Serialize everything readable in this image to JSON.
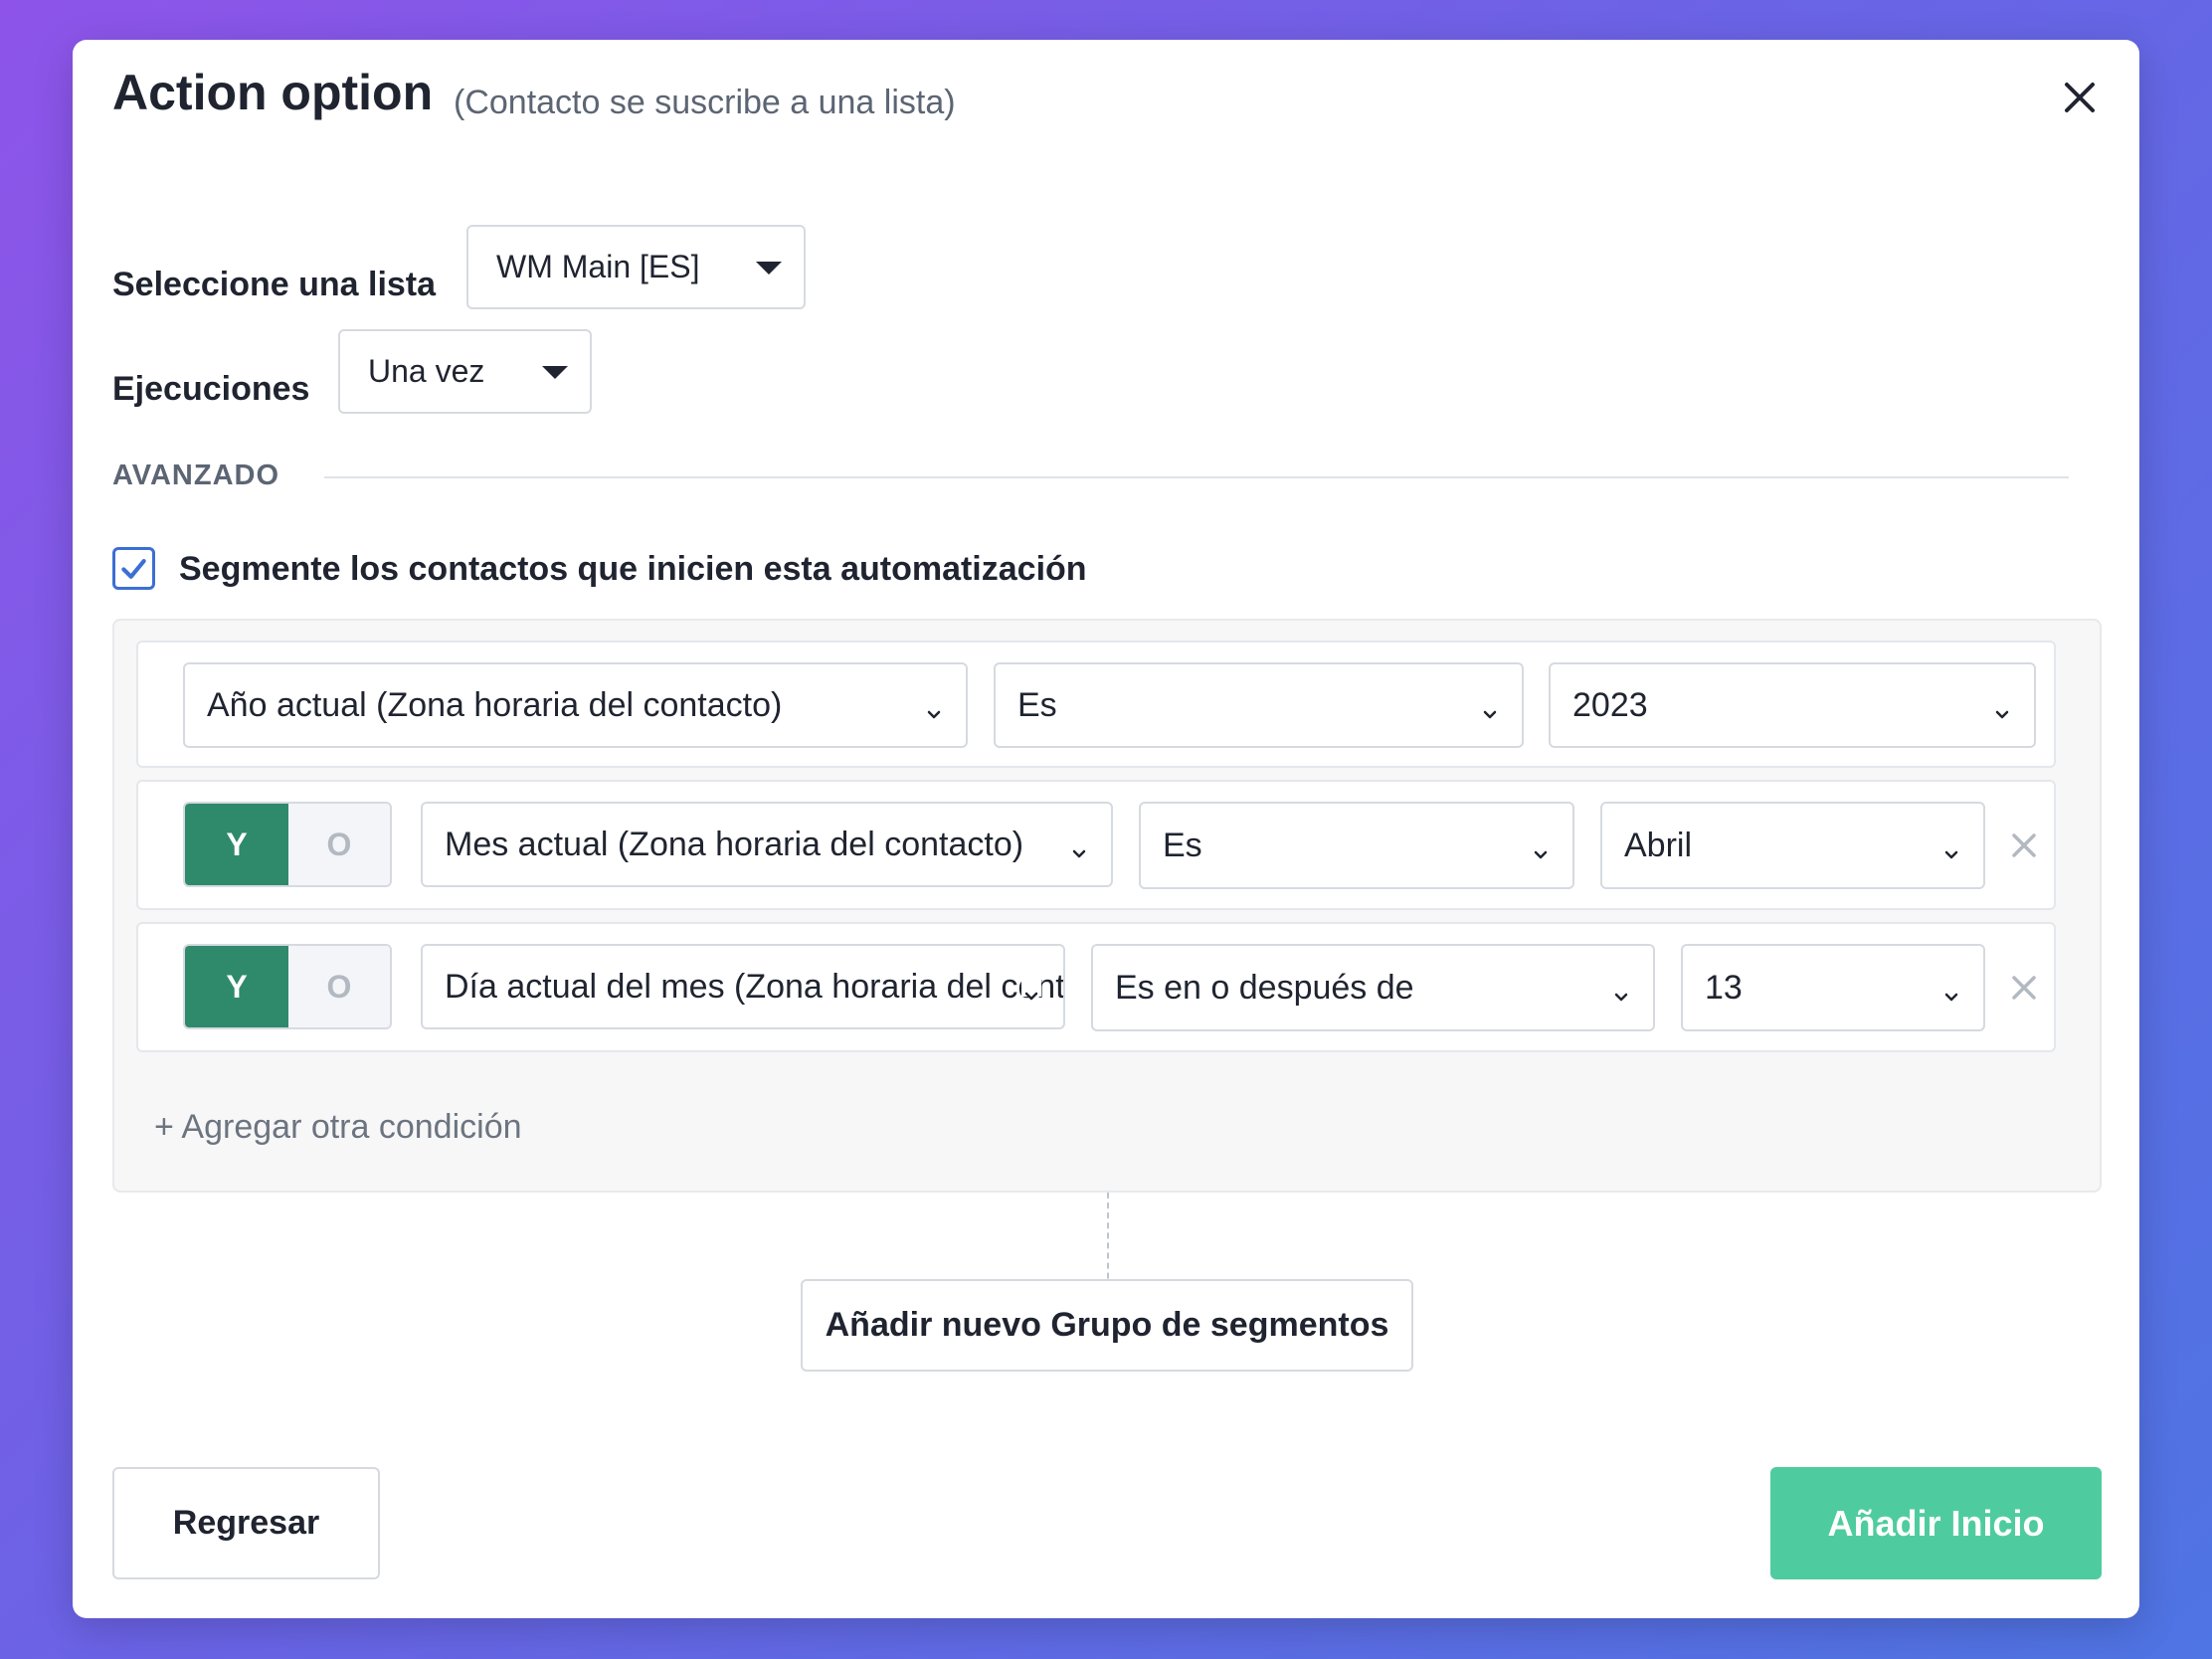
{
  "header": {
    "title": "Action option",
    "subtitle": "(Contacto se suscribe a una lista)"
  },
  "form": {
    "list_label": "Seleccione una lista",
    "list_value": "WM Main [ES]",
    "runs_label": "Ejecuciones",
    "runs_value": "Una vez"
  },
  "advanced": {
    "section_label": "AVANZADO",
    "segment_checkbox_label": "Segmente los contactos que inicien esta automatización",
    "segment_checked": true
  },
  "conditions": [
    {
      "field": "Año actual (Zona horaria del contacto)",
      "operator": "Es",
      "value": "2023"
    },
    {
      "connector_and": "Y",
      "connector_or": "O",
      "connector_selected": "Y",
      "field": "Mes actual (Zona horaria del contacto)",
      "operator": "Es",
      "value": "Abril"
    },
    {
      "connector_and": "Y",
      "connector_or": "O",
      "connector_selected": "Y",
      "field": "Día actual del mes (Zona horaria del contacto)",
      "operator": "Es en o después de",
      "value": "13"
    }
  ],
  "add_condition_label": "+ Agregar otra condición",
  "add_group_label": "Añadir nuevo Grupo de segmentos",
  "footer": {
    "back_label": "Regresar",
    "submit_label": "Añadir Inicio"
  },
  "colors": {
    "accent_green": "#2f8a6b",
    "primary_button": "#4fcc9f",
    "checkbox_blue": "#3b6fd4"
  },
  "icons": {
    "close": "close-icon",
    "dropdown": "caret-down-icon",
    "chevron": "chevron-down-icon",
    "remove": "remove-x-icon",
    "check": "checkmark-icon"
  }
}
